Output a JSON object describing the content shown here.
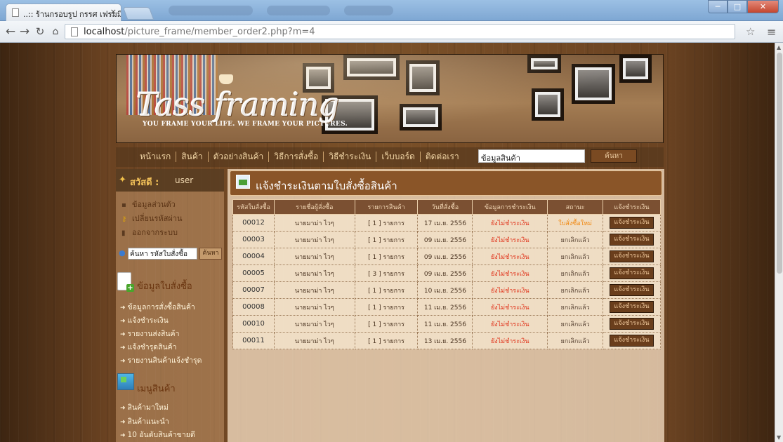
{
  "browser": {
    "tab_title": "..:: ร้านกรอบรูป กรรศ เฟรมมิ่ง",
    "tab_close": "×",
    "url_host": "localhost",
    "url_path": "/picture_frame/member_order2.php?m=4",
    "window_buttons": {
      "min": "─",
      "max": "□",
      "close": "✕"
    }
  },
  "banner": {
    "logo_text": "Tass framing",
    "tagline": "YOU FRAME YOUR LIFE. WE FRAME YOUR PICTURES."
  },
  "nav": {
    "items": [
      "หน้าแรก",
      "สินค้า",
      "ตัวอย่างสินค้า",
      "วิธีการสั่งซื้อ",
      "วิธีชำระเงิน",
      "เว็บบอร์ด",
      "ติดต่อเรา"
    ],
    "search_value": "ข้อมูลสินค้า",
    "search_button": "ค้นหา"
  },
  "sidebar": {
    "greeting": "สวัสดี :",
    "username": "user",
    "account_links": [
      "ข้อมูลส่วนตัว",
      "เปลี่ยนรหัสผ่าน",
      "ออกจากระบบ"
    ],
    "order_search_value": "ค้นหา รหัสใบสั่งซื้อ",
    "order_search_button": "ค้นหา",
    "order_section_title": "ข้อมูลใบสั่งซื้อ",
    "order_links": [
      "ข้อมูลการสั่งซื้อสินค้า",
      "แจ้งชำระเงิน",
      "รายงานส่งสินค้า",
      "แจ้งชำรุดสินค้า",
      "รายงานสินค้าแจ้งชำรุด"
    ],
    "product_section_title": "เมนูสินค้า",
    "product_links": [
      "สินค้ามาใหม่",
      "สินค้าแนะนำ",
      "10 อันดับสินค้าขายดี"
    ]
  },
  "content": {
    "title": "แจ้งชำระเงินตามใบสั่งซื้อสินค้า",
    "columns": [
      "รหัสใบสั่งซื้อ",
      "รายชื่อผู้สั่งซื้อ",
      "รายการสินค้า",
      "วันที่สั่งซื้อ",
      "ข้อมูลการชำระเงิน",
      "สถานะ",
      "แจ้งชำระเงิน"
    ],
    "rows": [
      {
        "id": "00012",
        "name": "นายมาม่า ไวๆ",
        "items": "[ 1 ] รายการ",
        "date": "17 เม.ย. 2556",
        "payment": "ยังไม่ชำระเงิน",
        "status": "ใบสั่งซื้อใหม่",
        "status_kind": "new",
        "action": "แจ้งชำระเงิน"
      },
      {
        "id": "00003",
        "name": "นายมาม่า ไวๆ",
        "items": "[ 1 ] รายการ",
        "date": "09 เม.ย. 2556",
        "payment": "ยังไม่ชำระเงิน",
        "status": "ยกเลิกแล้ว",
        "status_kind": "cancel",
        "action": "แจ้งชำระเงิน"
      },
      {
        "id": "00004",
        "name": "นายมาม่า ไวๆ",
        "items": "[ 1 ] รายการ",
        "date": "09 เม.ย. 2556",
        "payment": "ยังไม่ชำระเงิน",
        "status": "ยกเลิกแล้ว",
        "status_kind": "cancel",
        "action": "แจ้งชำระเงิน"
      },
      {
        "id": "00005",
        "name": "นายมาม่า ไวๆ",
        "items": "[ 3 ] รายการ",
        "date": "09 เม.ย. 2556",
        "payment": "ยังไม่ชำระเงิน",
        "status": "ยกเลิกแล้ว",
        "status_kind": "cancel",
        "action": "แจ้งชำระเงิน"
      },
      {
        "id": "00007",
        "name": "นายมาม่า ไวๆ",
        "items": "[ 1 ] รายการ",
        "date": "10 เม.ย. 2556",
        "payment": "ยังไม่ชำระเงิน",
        "status": "ยกเลิกแล้ว",
        "status_kind": "cancel",
        "action": "แจ้งชำระเงิน"
      },
      {
        "id": "00008",
        "name": "นายมาม่า ไวๆ",
        "items": "[ 1 ] รายการ",
        "date": "11 เม.ย. 2556",
        "payment": "ยังไม่ชำระเงิน",
        "status": "ยกเลิกแล้ว",
        "status_kind": "cancel",
        "action": "แจ้งชำระเงิน"
      },
      {
        "id": "00010",
        "name": "นายมาม่า ไวๆ",
        "items": "[ 1 ] รายการ",
        "date": "11 เม.ย. 2556",
        "payment": "ยังไม่ชำระเงิน",
        "status": "ยกเลิกแล้ว",
        "status_kind": "cancel",
        "action": "แจ้งชำระเงิน"
      },
      {
        "id": "00011",
        "name": "นายมาม่า ไวๆ",
        "items": "[ 1 ] รายการ",
        "date": "13 เม.ย. 2556",
        "payment": "ยังไม่ชำระเงิน",
        "status": "ยกเลิกแล้ว",
        "status_kind": "cancel",
        "action": "แจ้งชำระเงิน"
      }
    ]
  },
  "colors": {
    "payment_text": "#e03018",
    "status_new": "#f08810",
    "header_brown": "#8a5528"
  }
}
